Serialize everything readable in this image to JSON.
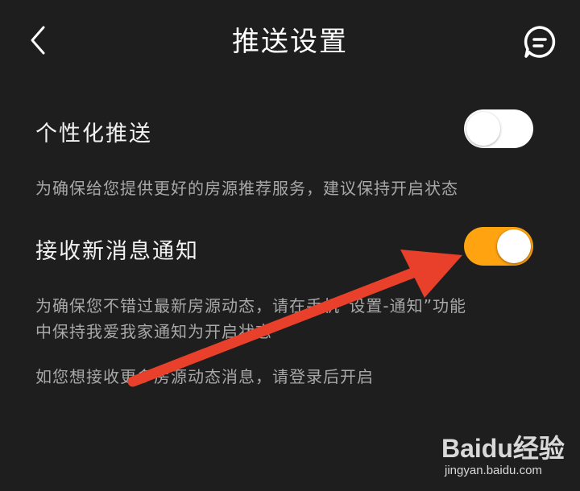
{
  "header": {
    "title": "推送设置",
    "back_icon": "chevron-left-icon",
    "message_icon": "message-bubble-icon"
  },
  "settings": [
    {
      "label": "个性化推送",
      "enabled": false,
      "description": "为确保给您提供更好的房源推荐服务，建议保持开启状态"
    },
    {
      "label": "接收新消息通知",
      "enabled": true,
      "description_line1": "为确保您不错过最新房源动态，请在手机“设置-通知”功能",
      "description_line2": "中保持我爱我家通知为开启状态"
    }
  ],
  "login_hint": "如您想接收更多房源动态消息，请登录后开启",
  "colors": {
    "background": "#1e1e1e",
    "toggle_on": "#ffa310",
    "toggle_off": "#ffffff",
    "arrow": "#e8402a"
  },
  "watermark": {
    "brand": "Baidu经验",
    "url": "jingyan.baidu.com"
  }
}
